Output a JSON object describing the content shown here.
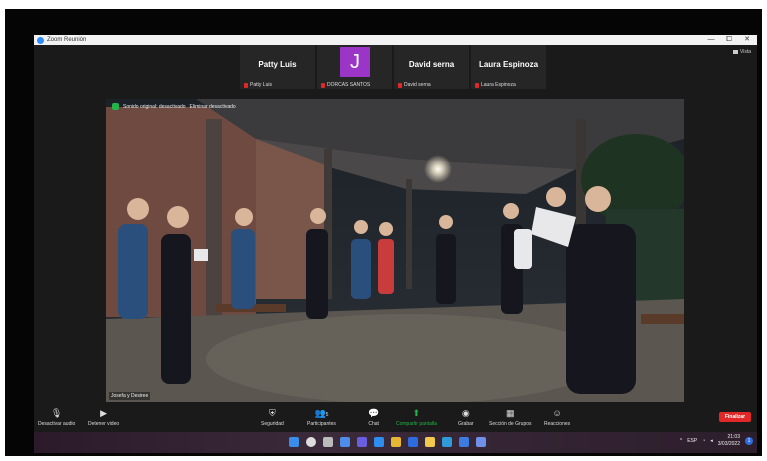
{
  "window": {
    "title": "Zoom Reunión",
    "controls": {
      "minimize": "—",
      "restore": "⧠",
      "close": "✕"
    },
    "view_label": "Vista"
  },
  "participants": [
    {
      "name": "Patty Luis",
      "label": "Patty Luis",
      "avatar": ""
    },
    {
      "name": "",
      "label": "DORCAS SANTOS",
      "avatar": "J"
    },
    {
      "name": "David serna",
      "label": "David serna",
      "avatar": ""
    },
    {
      "name": "Laura Espinoza",
      "label": "Laura Espinoza",
      "avatar": ""
    }
  ],
  "video": {
    "audio_status": "Sonido original: desactivado",
    "enhance_label": "Eliminar desactivado",
    "speaker_name": "Josefa y Desiree"
  },
  "toolbar": {
    "mute": "Desactivar audio",
    "stop_video": "Detener video",
    "security": "Seguridad",
    "participants": "Participantes",
    "participants_count": "5",
    "chat": "Chat",
    "share": "Compartir pantalla",
    "record": "Grabar",
    "breakout": "Sección de Grupos",
    "reactions": "Reacciones",
    "end": "Finalizar"
  },
  "taskbar": {
    "lang": "ESP",
    "time": "21:03",
    "date": "3/03/2022",
    "notif": "1"
  },
  "colors": {
    "accent": "#2d8cff",
    "end": "#e02828",
    "share": "#24b34a",
    "avatar": "#9b35c8"
  }
}
